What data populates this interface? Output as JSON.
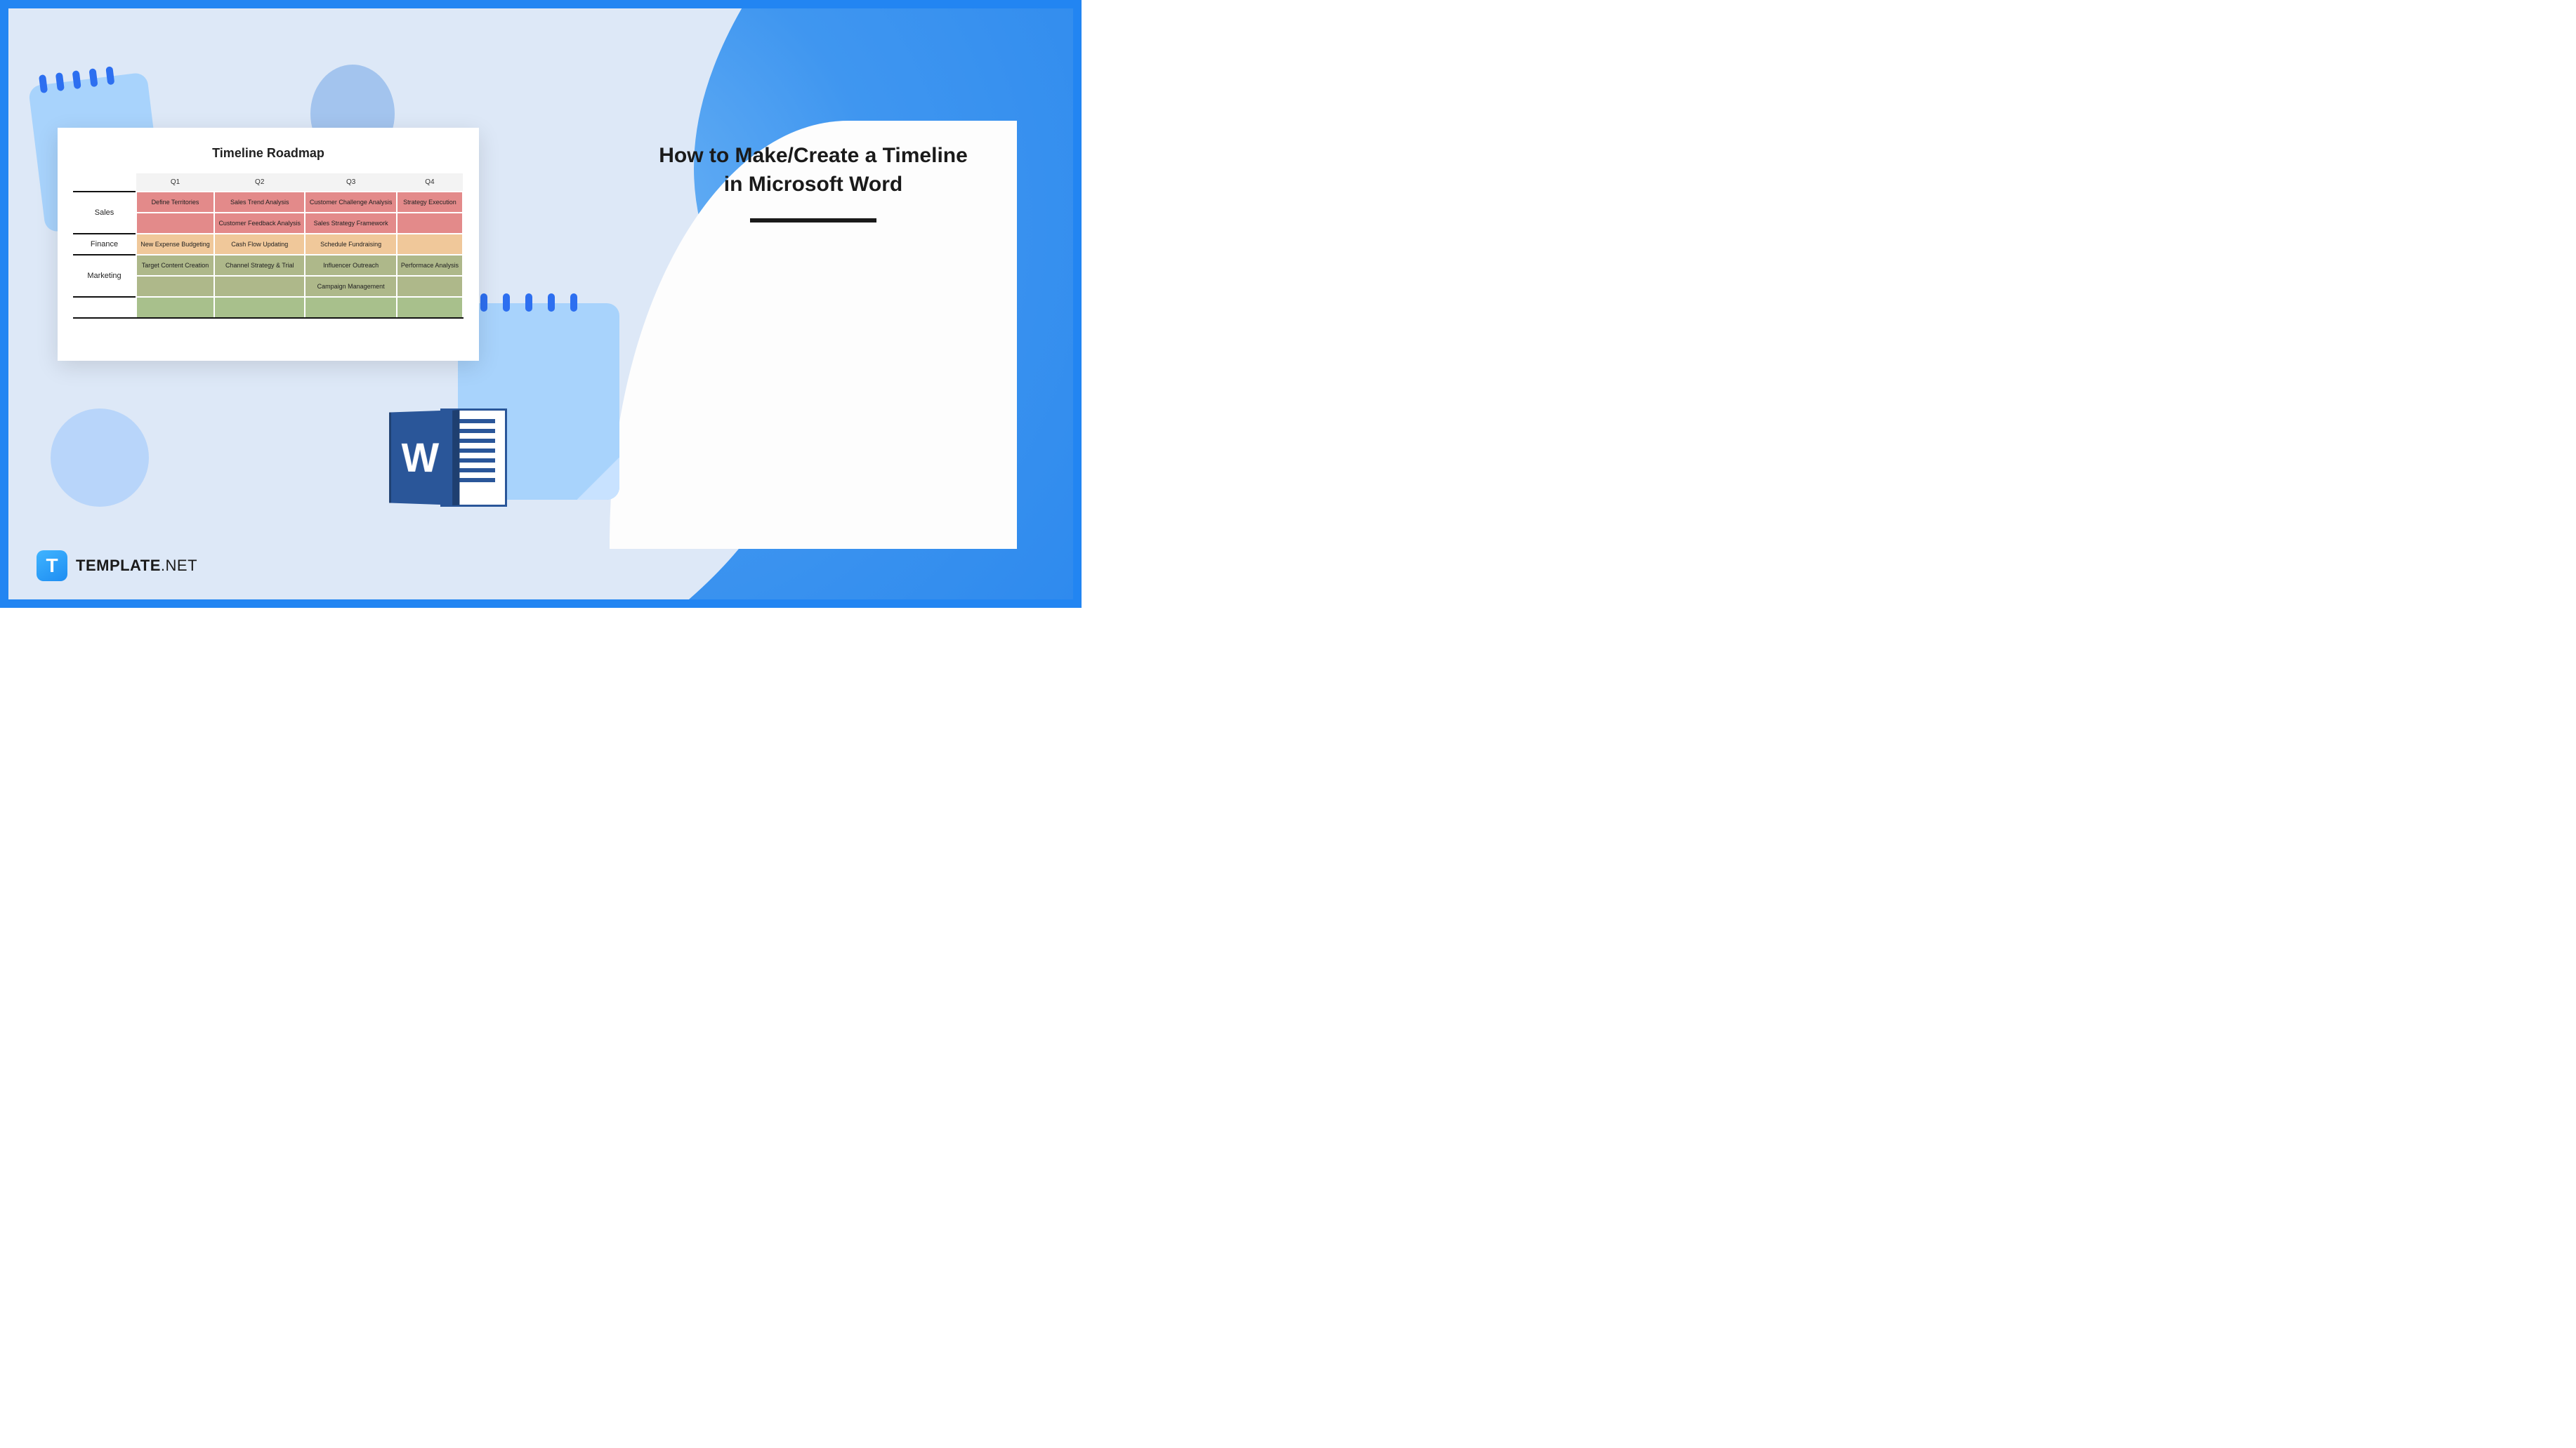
{
  "title": "How to Make/Create a Timeline in Microsoft Word",
  "document": {
    "heading": "Timeline Roadmap",
    "quarters": [
      "Q1",
      "Q2",
      "Q3",
      "Q4"
    ],
    "rows": {
      "sales": {
        "label": "Sales",
        "r1": [
          "Define Territories",
          "Sales Trend Analysis",
          "Customer Challenge Analysis",
          "Strategy Execution"
        ],
        "r2": [
          "",
          "Customer Feedback Analysis",
          "Sales Strategy Framework",
          ""
        ]
      },
      "finance": {
        "label": "Finance",
        "r1": [
          "New Expense Budgeting",
          "Cash Flow Updating",
          "Schedule Fundraising",
          ""
        ]
      },
      "marketing": {
        "label": "Marketing",
        "r1": [
          "Target Content Creation",
          "Channel Strategy & Trial",
          "Influencer Outreach",
          "Performace Analysis"
        ],
        "r2": [
          "",
          "",
          "Campaign Management",
          ""
        ]
      }
    }
  },
  "word_icon_letter": "W",
  "logo": {
    "badge": "T",
    "name": "TEMPLATE",
    "suffix": ".NET"
  }
}
